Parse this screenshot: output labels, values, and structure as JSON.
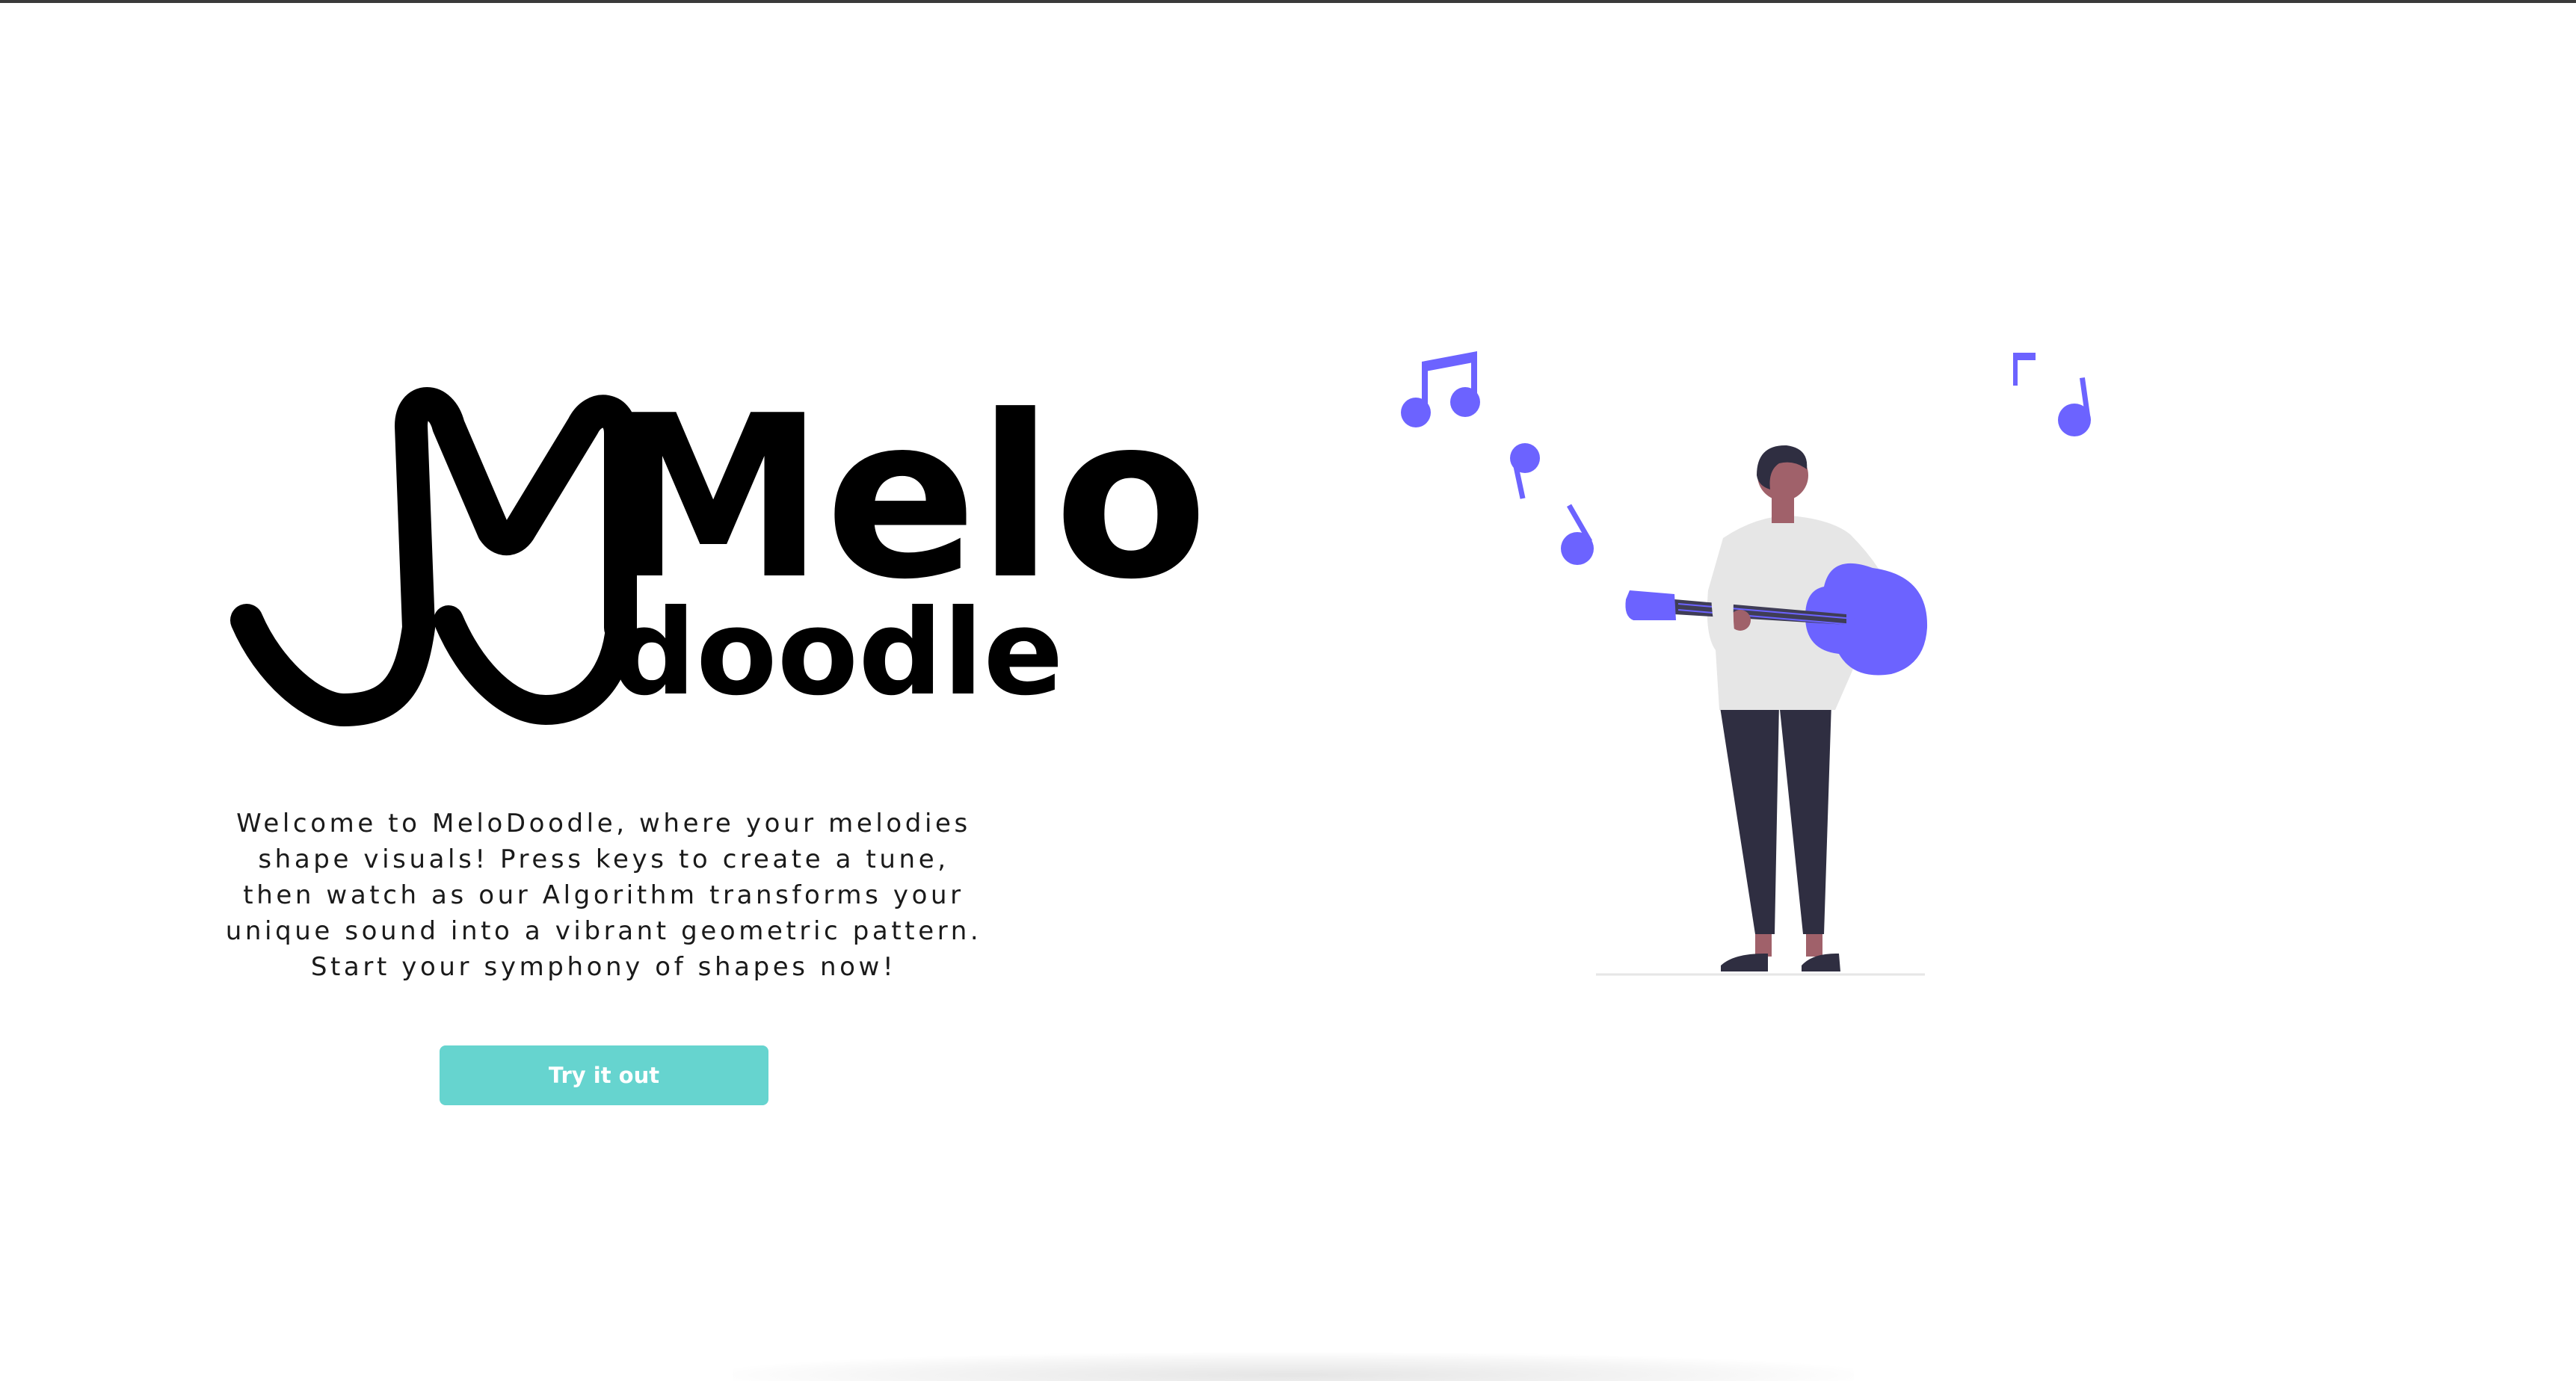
{
  "logo": {
    "line1": "Melo",
    "line2": "doodle",
    "color": "#000000"
  },
  "intro": {
    "lines": [
      "Welcome to MeloDoodle, where your melodies",
      "shape visuals! Press keys to create a tune,",
      "then watch as our Algorithm transforms your",
      "unique sound into a vibrant geometric pattern.",
      "Start your symphony of shapes now!"
    ]
  },
  "cta": {
    "label": "Try it out",
    "color": "#66d4cf"
  },
  "illustration": {
    "subject": "person playing guitar with music notes",
    "accent_color": "#6c63ff",
    "icons": [
      "music-note-icon",
      "guitar-icon"
    ]
  }
}
